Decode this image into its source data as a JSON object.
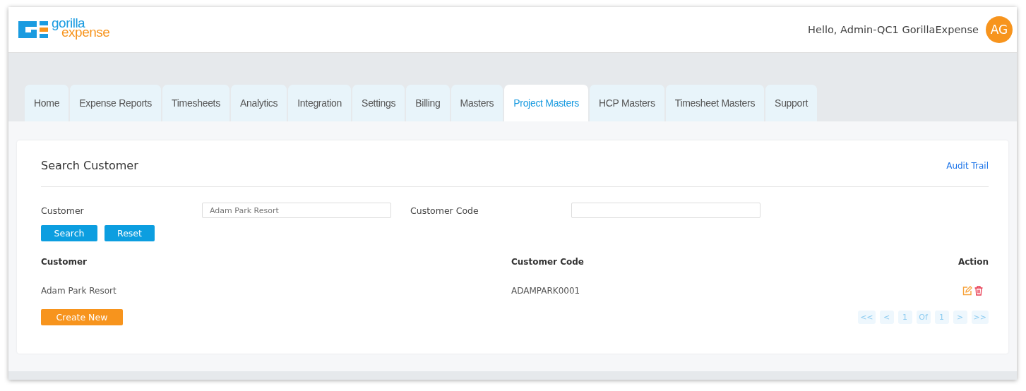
{
  "logo": {
    "line_1": "gorilla",
    "line_2": "expense"
  },
  "user": {
    "greeting": "Hello, Admin-QC1 GorillaExpense",
    "initials": "AG"
  },
  "tabs": [
    {
      "label": "Home",
      "selected": false
    },
    {
      "label": "Expense Reports",
      "selected": false
    },
    {
      "label": "Timesheets",
      "selected": false
    },
    {
      "label": "Analytics",
      "selected": false
    },
    {
      "label": "Integration",
      "selected": false
    },
    {
      "label": "Settings",
      "selected": false
    },
    {
      "label": "Billing",
      "selected": false
    },
    {
      "label": "Masters",
      "selected": false
    },
    {
      "label": "Project Masters",
      "selected": true
    },
    {
      "label": "HCP Masters",
      "selected": false
    },
    {
      "label": "Timesheet Masters",
      "selected": false
    },
    {
      "label": "Support",
      "selected": false
    }
  ],
  "panel": {
    "title": "Search Customer",
    "audit_link": "Audit Trail"
  },
  "filters": [
    {
      "label": "Customer",
      "value": "Adam Park Resort"
    },
    {
      "label": "Customer Code"
    }
  ],
  "buttons": {
    "search": "Search",
    "reset": "Reset",
    "create": "Create New"
  },
  "table": {
    "columns": [
      "Customer",
      "Customer Code",
      "Action"
    ],
    "rows": [
      {
        "customer": "Adam Park Resort",
        "code": "ADAMPARK0001"
      }
    ]
  },
  "pagination": [
    "<<",
    "<",
    "1",
    "Of",
    "1",
    ">",
    ">>"
  ]
}
